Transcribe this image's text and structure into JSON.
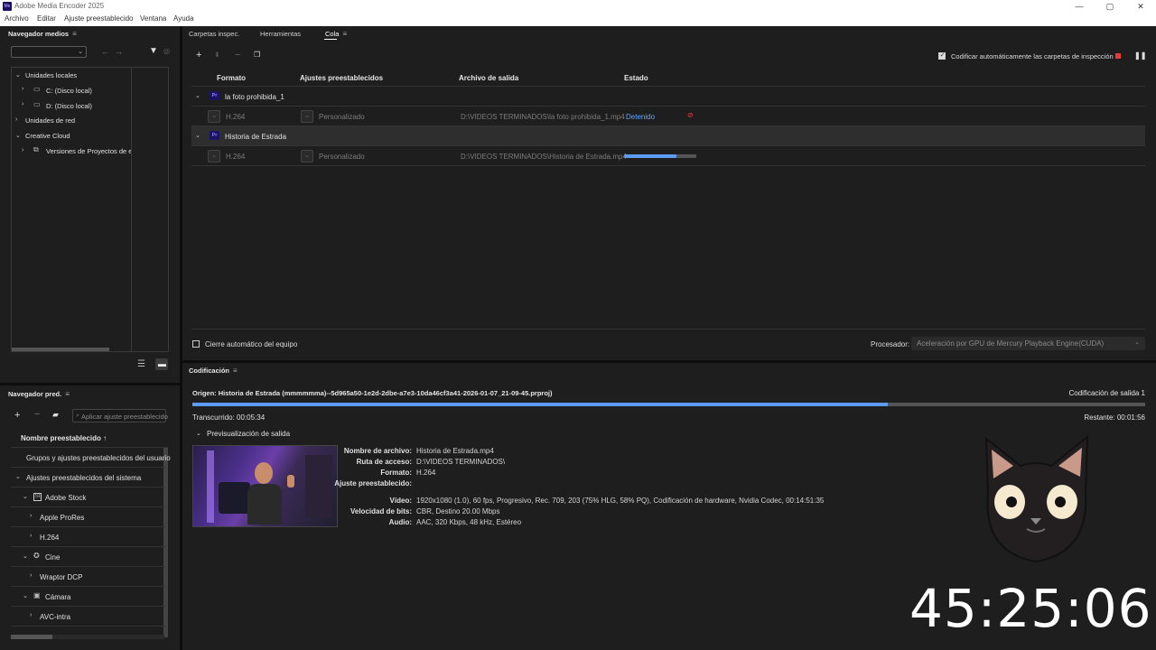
{
  "app": {
    "title": "Adobe Media Encoder 2025",
    "logo": "Me"
  },
  "window_buttons": {
    "minimize": "—",
    "maximize": "▢",
    "close": "✕"
  },
  "menu": [
    "Archivo",
    "Editar",
    "Ajuste preestablecido",
    "Ventana",
    "Ayuda"
  ],
  "media_browser": {
    "title": "Navegador medios",
    "tree": [
      {
        "label": "Unidades locales"
      },
      {
        "label": "C: (Disco local)"
      },
      {
        "label": "D: (Disco local)"
      },
      {
        "label": "Unidades de red"
      },
      {
        "label": "Creative Cloud"
      },
      {
        "label": "Versiones de Proyectos de eq"
      }
    ]
  },
  "queue_panel": {
    "tabs": [
      "Carpetas inspec.",
      "Herramientas",
      "Cola"
    ],
    "auto_encode_label": "Codificar automáticamente las carpetas de inspección",
    "columns": {
      "format": "Formato",
      "preset": "Ajustes preestablecidos",
      "output": "Archivo de salida",
      "status": "Estado"
    },
    "jobs": [
      {
        "name": "la foto prohibida_1",
        "format": "H.264",
        "preset": "Personalizado",
        "output": "D:\\VIDEOS TERMINADOS\\la foto prohibida_1.mp4",
        "status": "Detenido"
      },
      {
        "name": "Historia de Estrada",
        "format": "H.264",
        "preset": "Personalizado",
        "output": "D:\\VIDEOS TERMINADOS\\Historia de Estrada.mp4",
        "progress": 0.73
      }
    ],
    "shutdown_label": "Cierre automático del equipo",
    "processor_label": "Procesador:",
    "processor_value": "Aceleración por GPU de Mercury Playback Engine(CUDA)"
  },
  "preset_browser": {
    "title": "Navegador pred.",
    "search_placeholder": "Aplicar ajuste preestablecido",
    "column_header": "Nombre preestablecido ↑",
    "rows": [
      {
        "label": "Grupos y ajustes preestablecidos del usuario"
      },
      {
        "label": "Ajustes preestablecidos del sistema"
      },
      {
        "label": "Adobe Stock"
      },
      {
        "label": "Apple ProRes"
      },
      {
        "label": "H.264"
      },
      {
        "label": "Cine"
      },
      {
        "label": "Wraptor DCP"
      },
      {
        "label": "Cámara"
      },
      {
        "label": "AVC-intra"
      }
    ]
  },
  "encoding": {
    "title": "Codificación",
    "source": "Origen: Historia de Estrada (mmmmmma)--5d965a50-1e2d-2dbe-a7e3-10da46cf3a41-2026-01-07_21-09-45.prproj)",
    "output_count": "Codificación de salida 1",
    "progress": 0.73,
    "elapsed": "Transcurrido: 00:05:34",
    "remaining": "Restante: 00:01:56",
    "preview_label": "Previsualización de salida",
    "details": [
      {
        "label": "Nombre de archivo:",
        "value": "Historia de Estrada.mp4"
      },
      {
        "label": "Ruta de acceso:",
        "value": "D:\\VIDEOS TERMINADOS\\"
      },
      {
        "label": "Formato:",
        "value": "H.264"
      },
      {
        "label": "Ajuste preestablecido:",
        "value": ""
      },
      {
        "label": "Vídeo:",
        "value": "1920x1080 (1.0), 60 fps, Progresivo, Rec. 709, 203 (75% HLG, 58% PQ), Codificación de hardware, Nvidia Codec, 00:14:51:35"
      },
      {
        "label": "Velocidad de bits:",
        "value": "CBR, Destino 20.00 Mbps"
      },
      {
        "label": "Audio:",
        "value": "AAC, 320 Kbps, 48 kHz, Estéreo"
      }
    ]
  },
  "overlay": {
    "clock": "45:25:06"
  },
  "colors": {
    "accent": "#5ea7ff",
    "stop": "#e8383c",
    "progress": "#5b9bf5"
  }
}
